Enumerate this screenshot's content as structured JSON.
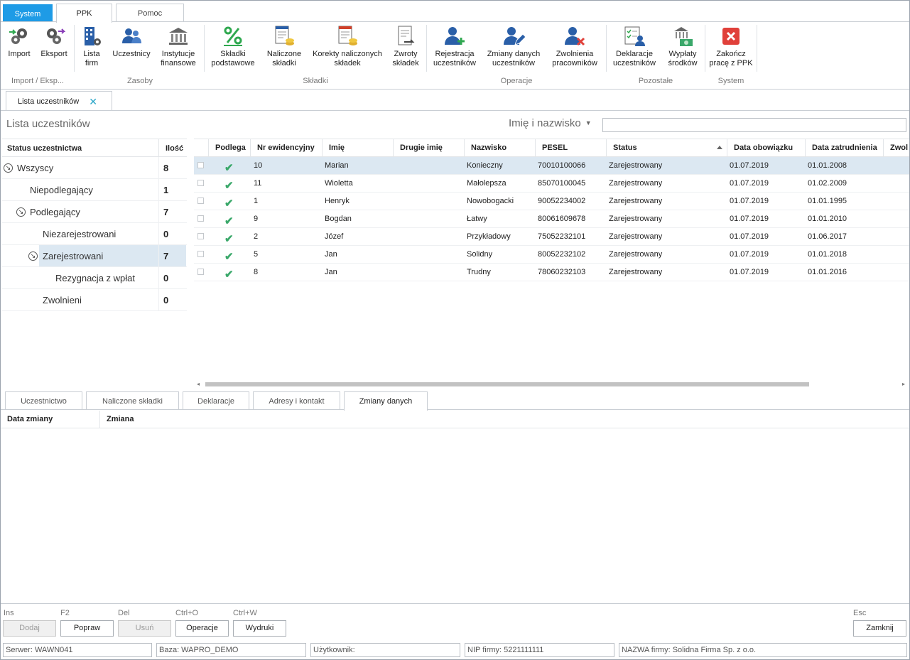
{
  "ribbon_tabs": [
    "System",
    "PPK",
    "Pomoc"
  ],
  "ribbon": {
    "buttons": {
      "import": "Import",
      "eksport": "Eksport",
      "lista_firm": [
        "Lista",
        "firm"
      ],
      "uczestnicy": "Uczestnicy",
      "instytucje": [
        "Instytucje",
        "finansowe"
      ],
      "skladki_podstawowe": [
        "Składki",
        "podstawowe"
      ],
      "naliczone_skladki": [
        "Naliczone",
        "składki"
      ],
      "korekty": [
        "Korekty naliczonych",
        "składek"
      ],
      "zwroty": [
        "Zwroty",
        "składek"
      ],
      "rejestracja": [
        "Rejestracja",
        "uczestników"
      ],
      "zmiany": [
        "Zmiany danych",
        "uczestników"
      ],
      "zwolnienia": [
        "Zwolnienia",
        "pracowników"
      ],
      "deklaracje": [
        "Deklaracje",
        "uczestników"
      ],
      "wyplaty": [
        "Wypłaty",
        "środków"
      ],
      "zakoncz": [
        "Zakończ",
        "pracę z PPK"
      ]
    },
    "groups": [
      "Import / Eksp...",
      "Zasoby",
      "Składki",
      "Operacje",
      "Pozostałe",
      "System"
    ]
  },
  "doc_tab": {
    "label": "Lista uczestników",
    "close": "✕"
  },
  "page_title": "Lista uczestników",
  "search": {
    "field_label": "Imię i nazwisko",
    "caret": "▼",
    "value": ""
  },
  "tree": {
    "headers": {
      "status": "Status uczestnictwa",
      "count": "Ilość"
    },
    "rows": [
      {
        "label": "Wszyscy",
        "count": "8"
      },
      {
        "label": "Niepodlegający",
        "count": "1"
      },
      {
        "label": "Podlegający",
        "count": "7"
      },
      {
        "label": "Niezarejestrowani",
        "count": "0"
      },
      {
        "label": "Zarejestrowani",
        "count": "7"
      },
      {
        "label": "Rezygnacja z wpłat",
        "count": "0"
      },
      {
        "label": "Zwolnieni",
        "count": "0"
      }
    ],
    "expand_glyph": "↘"
  },
  "grid": {
    "headers": [
      "Podlega",
      "Nr ewidencyjny",
      "Imię",
      "Drugie imię",
      "Nazwisko",
      "PESEL",
      "Status",
      "Data obowiązku",
      "Data zatrudnienia",
      "Zwol"
    ],
    "check_glyph": "✔",
    "rows": [
      {
        "nr": "10",
        "imie": "Marian",
        "drugie": "",
        "nazwisko": "Konieczny",
        "pesel": "70010100066",
        "status": "Zarejestrowany",
        "obow": "01.07.2019",
        "zatr": "01.01.2008"
      },
      {
        "nr": "11",
        "imie": "Wioletta",
        "drugie": "",
        "nazwisko": "Małolepsza",
        "pesel": "85070100045",
        "status": "Zarejestrowany",
        "obow": "01.07.2019",
        "zatr": "01.02.2009"
      },
      {
        "nr": "1",
        "imie": "Henryk",
        "drugie": "",
        "nazwisko": "Nowobogacki",
        "pesel": "90052234002",
        "status": "Zarejestrowany",
        "obow": "01.07.2019",
        "zatr": "01.01.1995"
      },
      {
        "nr": "9",
        "imie": "Bogdan",
        "drugie": "",
        "nazwisko": "Łatwy",
        "pesel": "80061609678",
        "status": "Zarejestrowany",
        "obow": "01.07.2019",
        "zatr": "01.01.2010"
      },
      {
        "nr": "2",
        "imie": "Józef",
        "drugie": "",
        "nazwisko": "Przykładowy",
        "pesel": "75052232101",
        "status": "Zarejestrowany",
        "obow": "01.07.2019",
        "zatr": "01.06.2017"
      },
      {
        "nr": "5",
        "imie": "Jan",
        "drugie": "",
        "nazwisko": "Solidny",
        "pesel": "80052232102",
        "status": "Zarejestrowany",
        "obow": "01.07.2019",
        "zatr": "01.01.2018"
      },
      {
        "nr": "8",
        "imie": "Jan",
        "drugie": "",
        "nazwisko": "Trudny",
        "pesel": "78060232103",
        "status": "Zarejestrowany",
        "obow": "01.07.2019",
        "zatr": "01.01.2016"
      }
    ]
  },
  "lower_tabs": [
    "Uczestnictwo",
    "Naliczone składki",
    "Deklaracje",
    "Adresy i kontakt",
    "Zmiany danych"
  ],
  "detail_headers": {
    "date": "Data zmiany",
    "change": "Zmiana"
  },
  "hotkeys": {
    "ins": "Ins",
    "f2": "F2",
    "del": "Del",
    "ctrlo": "Ctrl+O",
    "ctrlw": "Ctrl+W",
    "esc": "Esc"
  },
  "actions": {
    "dodaj": "Dodaj",
    "popraw": "Popraw",
    "usun": "Usuń",
    "operacje": "Operacje",
    "wydruki": "Wydruki",
    "zamknij": "Zamknij"
  },
  "statusbar": {
    "serwer": "Serwer: WAWN041",
    "baza": "Baza: WAPRO_DEMO",
    "uzytkownik": "Użytkownik:",
    "nip": "NIP firmy: 5221111111",
    "nazwa": "NAZWA firmy: Solidna Firma Sp. z o.o."
  },
  "colors": {
    "accent": "#1e9be6",
    "selected_row": "#dce8f2",
    "check": "#3aa86a",
    "icon_blue": "#2a5fa8",
    "close_red": "#e0403a"
  }
}
